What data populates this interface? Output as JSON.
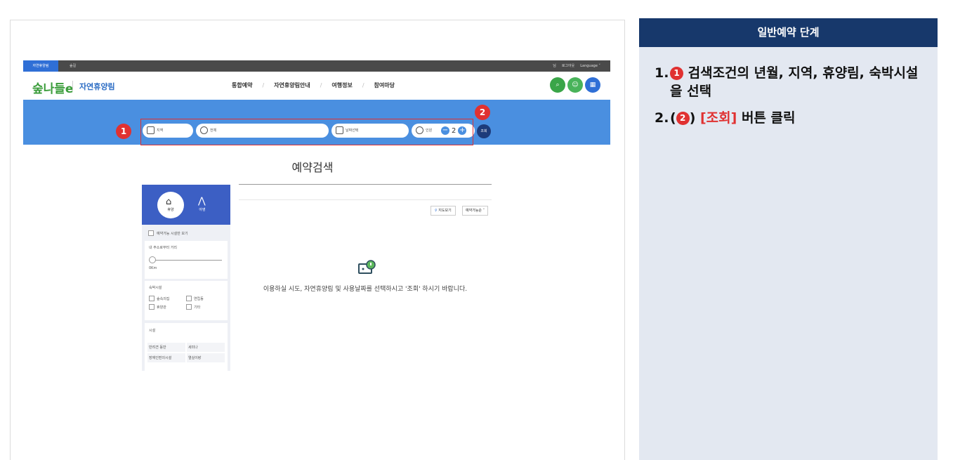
{
  "screenshot": {
    "topbar": {
      "home_tab": "자연휴양림",
      "camp_tab": "숲길",
      "user": "님",
      "logout": "로그아웃",
      "language": "Language ˅"
    },
    "header": {
      "logo_mark": "숲나들e",
      "logo_text": "자연휴양림",
      "nav": [
        "통합예약",
        "자연휴양림안내",
        "여행정보",
        "참여마당"
      ],
      "icons": [
        "search-icon",
        "mypage-icon",
        "menu-icon"
      ]
    },
    "search": {
      "region": "지역",
      "forest": "전체",
      "date": "날짜선택",
      "people_label": "인원",
      "people_count": "2",
      "query_button": "조회"
    },
    "badges": {
      "one": "1",
      "two": "2"
    },
    "page_title": "예약검색",
    "filter": {
      "tabs": [
        "휴양",
        "야영"
      ],
      "available_only": "예약가능 시설만 보기",
      "distance_label": "내 주소로부터 거리",
      "distance_value": "0Km",
      "lodging_label": "숙박시설",
      "lodging_options": [
        "숲속의집",
        "연립동",
        "휴양관",
        "기타"
      ],
      "facility_label": "시설",
      "facilities": [
        "반려견 동반",
        "세미나",
        "장애인편의시설",
        "열실이랑"
      ]
    },
    "map_button": "지도보기",
    "sort_button": "예약가능순 ˅",
    "empty_message": "이용하실 시도, 자연휴양림 및 사용날짜를 선택하시고 '조회' 하시기 바랍니다."
  },
  "panel": {
    "title": "일반예약 단계",
    "step1_num": "1.",
    "step1_badge": "1",
    "step1_text": " 검색조건의 년월, 지역, 휴양림, 숙박시설을 선택",
    "step2_num": "2.",
    "step2_open": "(",
    "step2_badge": "2",
    "step2_close": ")",
    "step2_highlight": "[조회]",
    "step2_text": " 버튼 클릭"
  },
  "colors": {
    "accent": "#4a8fe0",
    "badge": "#e03131",
    "panel_head": "#17386b"
  }
}
